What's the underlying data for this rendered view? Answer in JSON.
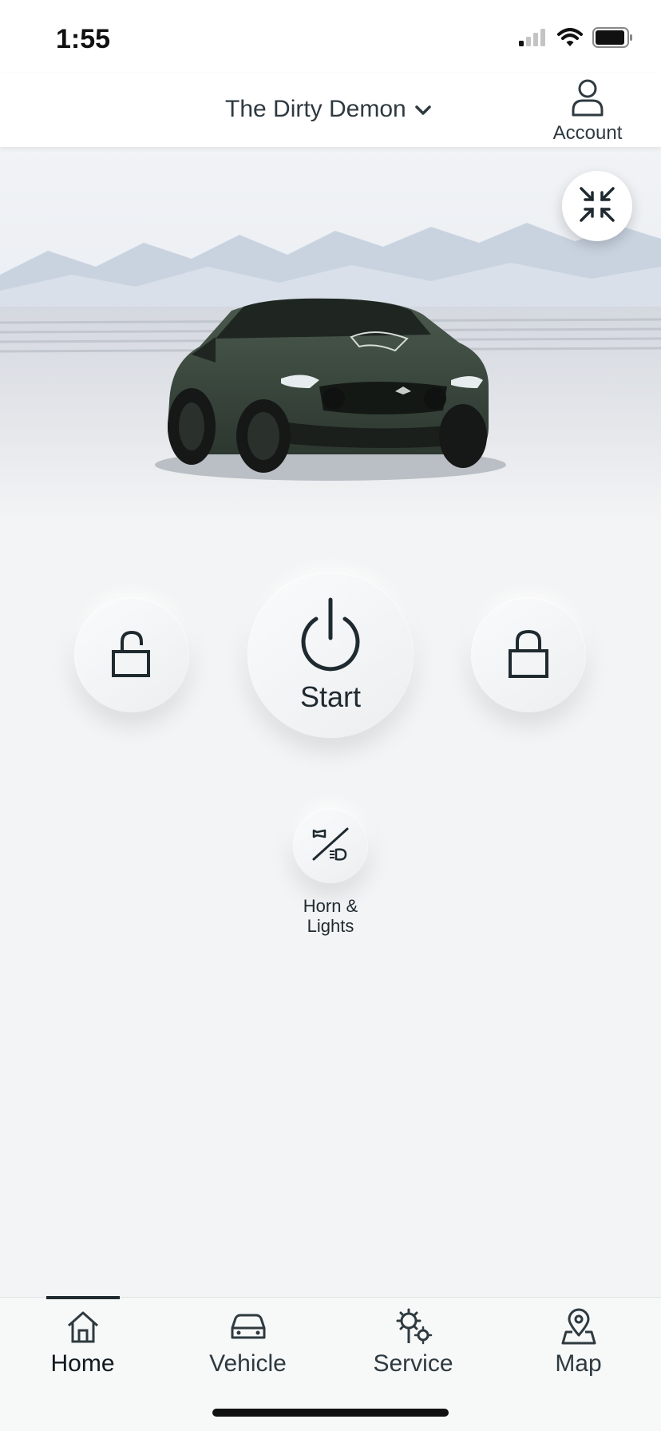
{
  "status_bar": {
    "time": "1:55",
    "icons": [
      "signal-icon",
      "wifi-icon",
      "battery-icon"
    ]
  },
  "header": {
    "vehicle_name": "The Dirty Demon",
    "account_label": "Account"
  },
  "hero": {
    "image": "vehicle-image",
    "vehicle_color": "#3a4a3e"
  },
  "controls": {
    "unlock_icon": "unlock-icon",
    "start_label": "Start",
    "lock_icon": "lock-icon",
    "horn_label_line1": "Horn &",
    "horn_label_line2": "Lights"
  },
  "bottom_nav": {
    "items": [
      {
        "label": "Home",
        "icon": "home-icon",
        "active": true
      },
      {
        "label": "Vehicle",
        "icon": "car-icon",
        "active": false
      },
      {
        "label": "Service",
        "icon": "service-gears-icon",
        "active": false
      },
      {
        "label": "Map",
        "icon": "map-pin-icon",
        "active": false
      }
    ]
  },
  "colors": {
    "background": "#f3f4f5",
    "text": "#1f2a30",
    "header_bg": "#ffffff"
  }
}
